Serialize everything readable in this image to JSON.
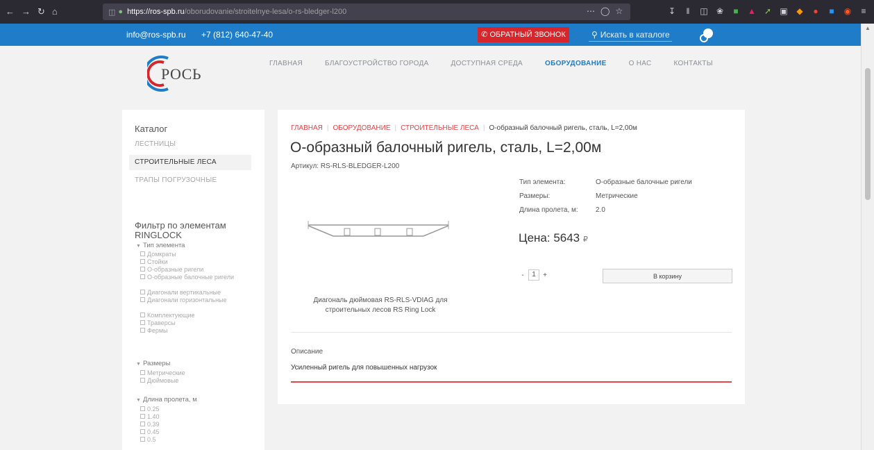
{
  "browser": {
    "url_host": "https://ros-spb.ru",
    "url_path": "/oborudovanie/stroitelnye-lesa/o-rs-bledger-l200"
  },
  "topbar": {
    "email": "info@ros-spb.ru",
    "phone": "+7 (812) 640-47-40",
    "callback_label": "ОБРАТНЫЙ ЗВОНОК",
    "search_placeholder": "Искать в каталоге"
  },
  "logo_text": "РОСЬ",
  "nav": {
    "items": [
      "ГЛАВНАЯ",
      "БЛАГОУСТРОЙСТВО ГОРОДА",
      "ДОСТУПНАЯ СРЕДА",
      "ОБОРУДОВАНИЕ",
      "О НАС",
      "КОНТАКТЫ"
    ],
    "active": "ОБОРУДОВАНИЕ"
  },
  "sidebar": {
    "catalog_title": "Каталог",
    "categories": [
      "ЛЕСТНИЦЫ",
      "СТРОИТЕЛЬНЫЕ ЛЕСА",
      "ТРАПЫ ПОГРУЗОЧНЫЕ"
    ],
    "filter_title": "Фильтр по элементам RINGLOCK",
    "groups": [
      {
        "label": "Тип элемента",
        "options": [
          "Домкраты",
          "Стойки",
          "О-образные ригели",
          "О-образные балочные ригели",
          "Диагонали вертикальные",
          "Диагонали горизонтальные",
          "Комплектующие",
          "Траверсы",
          "Фермы"
        ]
      },
      {
        "label": "Размеры",
        "options": [
          "Метрические",
          "Дюймовые"
        ]
      },
      {
        "label": "Длина пролета, м",
        "options": [
          "0.25",
          "1.40",
          "0.39",
          "0.45",
          "0.5"
        ]
      }
    ]
  },
  "product": {
    "breadcrumb": [
      "ГЛАВНАЯ",
      "ОБОРУДОВАНИЕ",
      "СТРОИТЕЛЬНЫЕ ЛЕСА"
    ],
    "breadcrumb_current": "О-образный балочный ригель, сталь, L=2,00м",
    "title": "О-образный балочный ригель, сталь, L=2,00м",
    "sku": "Артикул: RS-RLS-BLEDGER-L200",
    "image_caption": "Диагональ дюймовая RS-RLS-VDIAG для строительных лесов RS Ring Lock",
    "attributes": [
      {
        "key": "Тип элемента:",
        "value": "О-образные балочные ригели"
      },
      {
        "key": "Размеры:",
        "value": "Метрические"
      },
      {
        "key": "Длина пролета, м:",
        "value": "2.0"
      }
    ],
    "price_label": "Цена: 5643",
    "currency": "₽",
    "quantity": "1",
    "qty_minus": "-",
    "qty_plus": "+",
    "cart_label": "В корзину",
    "description_title": "Описание",
    "description_text": "Усиленный ригель для повышенных нагрузок"
  }
}
